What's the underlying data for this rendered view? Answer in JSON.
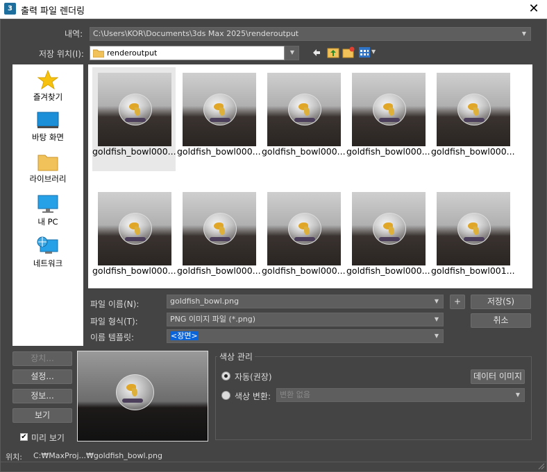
{
  "window": {
    "icon_text": "3",
    "title": "출력 파일 렌더링",
    "close_glyph": "✕"
  },
  "history": {
    "label": "내역:",
    "value": "C:\\Users\\KOR\\Documents\\3ds Max 2025\\renderoutput"
  },
  "save_in": {
    "label": "저장 위치(I):",
    "value": "renderoutput"
  },
  "places": [
    {
      "label": "즐겨찾기",
      "icon": "star-icon"
    },
    {
      "label": "바탕 화면",
      "icon": "desktop-icon"
    },
    {
      "label": "라이브러리",
      "icon": "folder-icon"
    },
    {
      "label": "내 PC",
      "icon": "monitor-icon"
    },
    {
      "label": "네트워크",
      "icon": "network-icon"
    }
  ],
  "files": [
    "goldfish_bowl000...",
    "goldfish_bowl000...",
    "goldfish_bowl000...",
    "goldfish_bowl000...",
    "goldfish_bowl000...",
    "goldfish_bowl000...",
    "goldfish_bowl000...",
    "goldfish_bowl000...",
    "goldfish_bowl000...",
    "goldfish_bowl001..."
  ],
  "filename": {
    "label": "파일 이름(N):",
    "value": "goldfish_bowl.png"
  },
  "filetype": {
    "label": "파일 형식(T):",
    "value": "PNG 이미지 파일 (*.png)"
  },
  "template": {
    "label": "이름 템플릿:",
    "value": "<장면>"
  },
  "buttons": {
    "add": "+",
    "save": "저장(S)",
    "cancel": "취소",
    "devices": "장치...",
    "setup": "설정...",
    "info": "정보...",
    "view": "보기"
  },
  "preview_checkbox": {
    "label": "미리 보기",
    "checked": true
  },
  "color_mgmt": {
    "title": "색상 관리",
    "auto_label": "자동(권장)",
    "data_image_button": "데이터 이미지",
    "convert_label": "색상 변환:",
    "convert_value": "변환 없음"
  },
  "location": {
    "label": "위치:",
    "value": "C:₩MaxProj...₩goldfish_bowl.png"
  },
  "colors": {
    "dialog_bg": "#444444",
    "selection": "#0a64d8"
  }
}
